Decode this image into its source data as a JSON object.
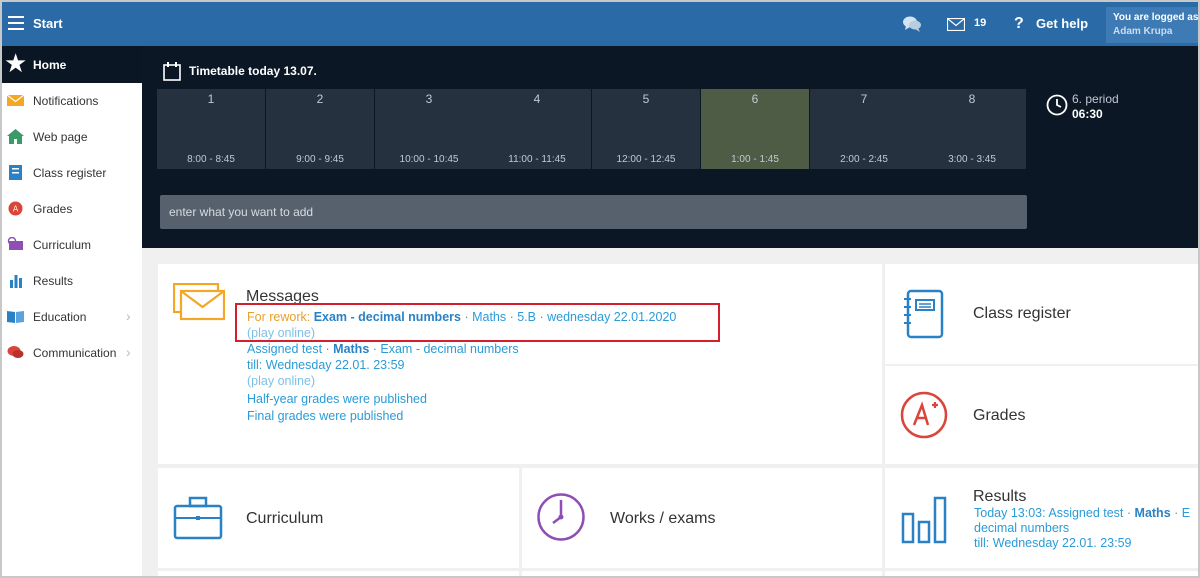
{
  "topbar": {
    "start_label": "Start",
    "mail_count": "19",
    "help_label": "Get help",
    "user_line1": "You are logged as",
    "user_line2": "Adam Krupa"
  },
  "sidebar": {
    "home_label": "Home",
    "items": [
      {
        "label": "Notifications",
        "icon": "envelope-icon",
        "color": "#f5a623"
      },
      {
        "label": "Web page",
        "icon": "house-icon",
        "color": "#3a9a6a"
      },
      {
        "label": "Class register",
        "icon": "register-icon",
        "color": "#2a82c6"
      },
      {
        "label": "Grades",
        "icon": "grade-icon",
        "color": "#d9453a"
      },
      {
        "label": "Curriculum",
        "icon": "curriculum-icon",
        "color": "#8e4fb4"
      },
      {
        "label": "Results",
        "icon": "chart-icon",
        "color": "#2a82c6"
      },
      {
        "label": "Education",
        "icon": "book-icon",
        "color": "#2a82c6"
      },
      {
        "label": "Communication",
        "icon": "chat-icon",
        "color": "#d9453a"
      }
    ]
  },
  "timetable": {
    "title": "Timetable today 13.07.",
    "periods": [
      {
        "num": "1",
        "time": "8:00 - 8:45"
      },
      {
        "num": "2",
        "time": "9:00 - 9:45"
      },
      {
        "num": "3",
        "time": "10:00 - 10:45"
      },
      {
        "num": "4",
        "time": "11:00 - 11:45"
      },
      {
        "num": "5",
        "time": "12:00 - 12:45"
      },
      {
        "num": "6",
        "time": "1:00 - 1:45"
      },
      {
        "num": "7",
        "time": "2:00 - 2:45"
      },
      {
        "num": "8",
        "time": "3:00 - 3:45"
      }
    ],
    "active_period": "6",
    "current_period": "6. period",
    "current_time": "06:30",
    "input_placeholder": "enter what you want to add"
  },
  "messages": {
    "title": "Messages",
    "rework_prefix": "For rework:",
    "rework_item": "Exam - decimal numbers",
    "rework_meta": " · Maths · 5.B · wednesday 22.01.2020",
    "play_online_1": "(play online)",
    "assigned_prefix": "Assigned test · ",
    "assigned_subject": "Maths",
    "assigned_title": " · Exam - decimal numbers",
    "assigned_till": "till: Wednesday 22.01. 23:59",
    "play_online_2": "(play online)",
    "halfyear": "Half-year grades were published",
    "final": "Final grades were published"
  },
  "cards": {
    "class_register": "Class register",
    "grades": "Grades",
    "curriculum": "Curriculum",
    "works": "Works / exams",
    "results": "Results"
  },
  "results": {
    "line1_prefix": "Today 13:03: Assigned test · ",
    "line1_subject": "Maths",
    "line1_suffix": " · E",
    "line2": "decimal numbers",
    "line3": "till: Wednesday 22.01. 23:59"
  },
  "colors": {
    "topbar": "#2a6aa6",
    "dark": "#0b1725",
    "link": "#2a9bd8",
    "orange": "#e8a02a",
    "highlight": "#d4202e",
    "accent_blue": "#2a82c6",
    "accent_red": "#d9453a",
    "accent_purple": "#8e4fb4"
  }
}
